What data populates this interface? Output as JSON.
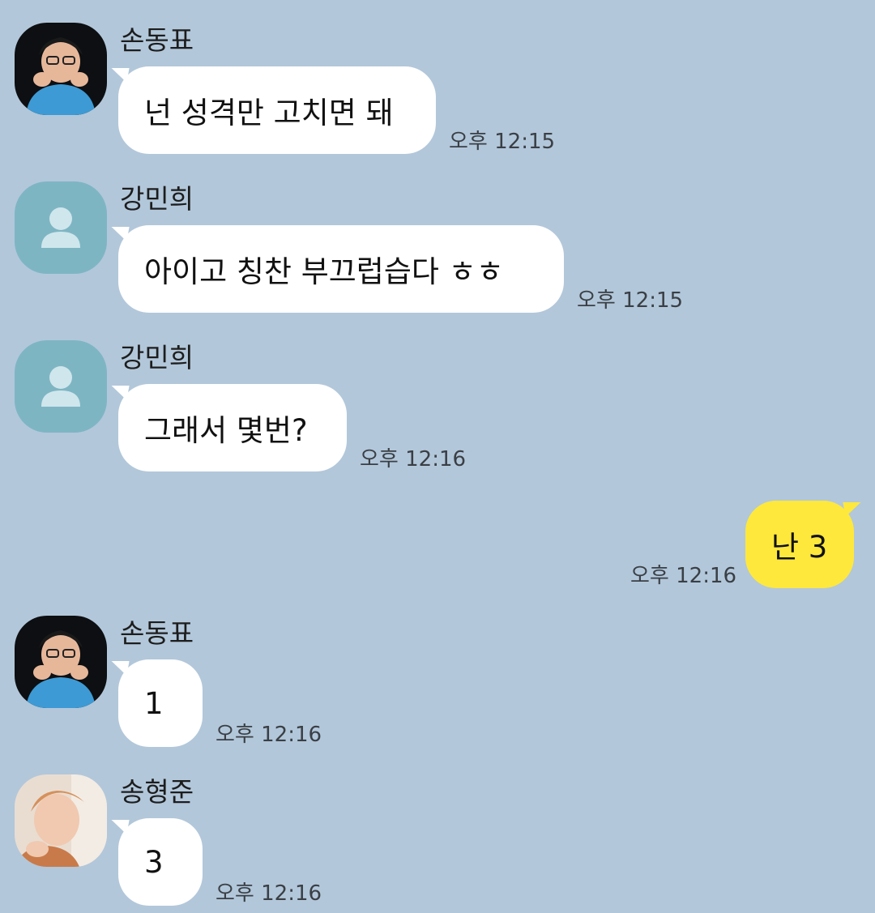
{
  "messages": [
    {
      "sender": "손동표",
      "text": "넌 성격만 고치면 돼",
      "time": "오후 12:15",
      "avatar": "photo-avatar"
    },
    {
      "sender": "강민희",
      "text": "아이고 칭찬 부끄럽습다 ㅎㅎ",
      "time": "오후 12:15",
      "avatar": "default-person-icon"
    },
    {
      "sender": "강민희",
      "text": "그래서 몇번?",
      "time": "오후 12:16",
      "avatar": "default-person-icon"
    },
    {
      "sender": "",
      "text": "난 3",
      "time": "오후 12:16",
      "avatar": ""
    },
    {
      "sender": "손동표",
      "text": "1",
      "time": "오후 12:16",
      "avatar": "photo-avatar"
    },
    {
      "sender": "송형준",
      "text": "3",
      "time": "오후 12:16",
      "avatar": "photo-avatar"
    }
  ],
  "colors": {
    "background": "#b2c7da",
    "incoming_bubble": "#ffffff",
    "outgoing_bubble": "#fee83c",
    "default_avatar": "#7eb5c3"
  }
}
